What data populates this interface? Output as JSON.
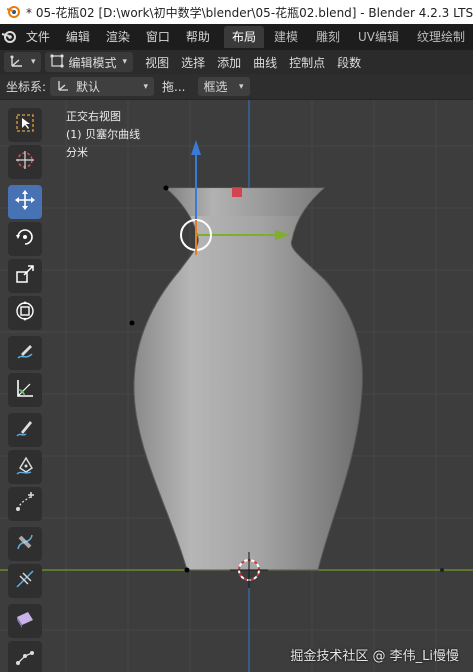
{
  "window": {
    "title": "* 05-花瓶02 [D:\\work\\初中数学\\blender\\05-花瓶02.blend] - Blender 4.2.3 LTS"
  },
  "menu": {
    "items": [
      "文件",
      "编辑",
      "渲染",
      "窗口",
      "帮助"
    ],
    "workspaces": [
      "布局",
      "建模",
      "雕刻",
      "UV编辑",
      "纹理绘制"
    ],
    "active_workspace": "布局"
  },
  "header": {
    "mode": "编辑模式",
    "items": [
      "视图",
      "选择",
      "添加",
      "曲线",
      "控制点",
      "段数"
    ]
  },
  "toolsettings": {
    "coord_label": "坐标系:",
    "coord_value": "默认",
    "drag_label": "拖...",
    "select_value": "框选"
  },
  "viewport": {
    "view_name": "正交右视图",
    "object_name": "(1) 贝塞尔曲线",
    "unit": "分米"
  },
  "tools": [
    "select-box",
    "cursor",
    "move",
    "rotate",
    "scale",
    "transform",
    "annotate",
    "measure",
    "draw",
    "pen",
    "extrude",
    "radius",
    "tilt",
    "randomize",
    "shrink-fatten"
  ],
  "watermark": "掘金技术社区 @ 李伟_Li慢慢",
  "colors": {
    "accent": "#4772b3",
    "x_axis": "#7fae2a",
    "y_axis": "#3a7ad4",
    "gizmo_red": "#d9343f"
  }
}
